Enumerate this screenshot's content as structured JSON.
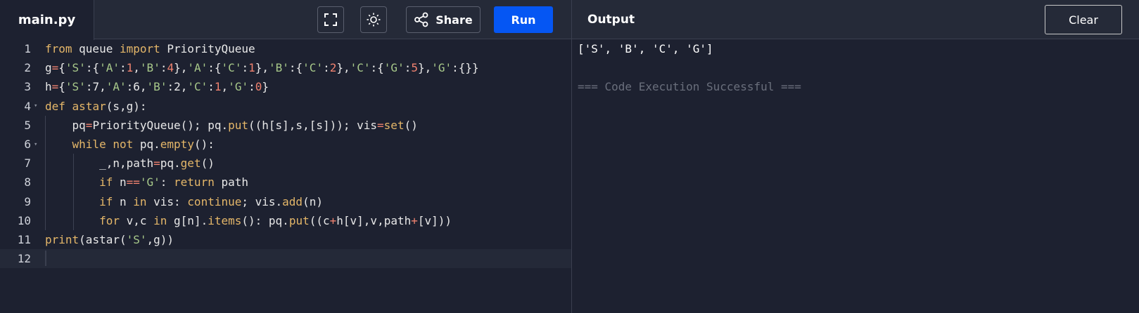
{
  "editor": {
    "file_tab": "main.py",
    "lines": [
      {
        "n": "1",
        "html_tokens": [
          [
            "kw",
            "from"
          ],
          [
            "t",
            " queue "
          ],
          [
            "kw",
            "import"
          ],
          [
            "t",
            " PriorityQueue"
          ]
        ]
      },
      {
        "n": "2",
        "html_tokens": [
          [
            "t",
            "g"
          ],
          [
            "op",
            "="
          ],
          [
            "t",
            "{"
          ],
          [
            "str",
            "'S'"
          ],
          [
            "t",
            ":{"
          ],
          [
            "str",
            "'A'"
          ],
          [
            "t",
            ":"
          ],
          [
            "num",
            "1"
          ],
          [
            "t",
            ","
          ],
          [
            "str",
            "'B'"
          ],
          [
            "t",
            ":"
          ],
          [
            "num",
            "4"
          ],
          [
            "t",
            "},"
          ],
          [
            "str",
            "'A'"
          ],
          [
            "t",
            ":{"
          ],
          [
            "str",
            "'C'"
          ],
          [
            "t",
            ":"
          ],
          [
            "num",
            "1"
          ],
          [
            "t",
            "},"
          ],
          [
            "str",
            "'B'"
          ],
          [
            "t",
            ":{"
          ],
          [
            "str",
            "'C'"
          ],
          [
            "t",
            ":"
          ],
          [
            "num",
            "2"
          ],
          [
            "t",
            "},"
          ],
          [
            "str",
            "'C'"
          ],
          [
            "t",
            ":{"
          ],
          [
            "str",
            "'G'"
          ],
          [
            "t",
            ":"
          ],
          [
            "num",
            "5"
          ],
          [
            "t",
            "},"
          ],
          [
            "str",
            "'G'"
          ],
          [
            "t",
            ":{}}"
          ]
        ]
      },
      {
        "n": "3",
        "html_tokens": [
          [
            "t",
            "h"
          ],
          [
            "op",
            "="
          ],
          [
            "t",
            "{"
          ],
          [
            "str",
            "'S'"
          ],
          [
            "t",
            ":7,"
          ],
          [
            "str",
            "'A'"
          ],
          [
            "t",
            ":6,"
          ],
          [
            "str",
            "'B'"
          ],
          [
            "t",
            ":2,"
          ],
          [
            "str",
            "'C'"
          ],
          [
            "t",
            ":"
          ],
          [
            "num",
            "1"
          ],
          [
            "t",
            ","
          ],
          [
            "str",
            "'G'"
          ],
          [
            "t",
            ":"
          ],
          [
            "num",
            "0"
          ],
          [
            "t",
            "}"
          ]
        ]
      },
      {
        "n": "4",
        "fold": true,
        "html_tokens": [
          [
            "kw",
            "def"
          ],
          [
            "t",
            " "
          ],
          [
            "fn",
            "astar"
          ],
          [
            "t",
            "(s,g):"
          ]
        ]
      },
      {
        "n": "5",
        "html_tokens": [
          [
            "t",
            "    pq"
          ],
          [
            "op",
            "="
          ],
          [
            "t",
            "PriorityQueue(); pq."
          ],
          [
            "fn",
            "put"
          ],
          [
            "t",
            "((h[s],s,[s])); vis"
          ],
          [
            "op",
            "="
          ],
          [
            "fn",
            "set"
          ],
          [
            "t",
            "()"
          ]
        ]
      },
      {
        "n": "6",
        "fold": true,
        "html_tokens": [
          [
            "t",
            "    "
          ],
          [
            "kw",
            "while"
          ],
          [
            "t",
            " "
          ],
          [
            "kw",
            "not"
          ],
          [
            "t",
            " pq."
          ],
          [
            "fn",
            "empty"
          ],
          [
            "t",
            "():"
          ]
        ]
      },
      {
        "n": "7",
        "html_tokens": [
          [
            "t",
            "        _,n,path"
          ],
          [
            "op",
            "="
          ],
          [
            "t",
            "pq."
          ],
          [
            "fn",
            "get"
          ],
          [
            "t",
            "()"
          ]
        ]
      },
      {
        "n": "8",
        "html_tokens": [
          [
            "t",
            "        "
          ],
          [
            "kw",
            "if"
          ],
          [
            "t",
            " n"
          ],
          [
            "op",
            "=="
          ],
          [
            "str",
            "'G'"
          ],
          [
            "t",
            ": "
          ],
          [
            "kw",
            "return"
          ],
          [
            "t",
            " path"
          ]
        ]
      },
      {
        "n": "9",
        "html_tokens": [
          [
            "t",
            "        "
          ],
          [
            "kw",
            "if"
          ],
          [
            "t",
            " n "
          ],
          [
            "kw",
            "in"
          ],
          [
            "t",
            " vis: "
          ],
          [
            "kw",
            "continue"
          ],
          [
            "t",
            "; vis."
          ],
          [
            "fn",
            "add"
          ],
          [
            "t",
            "(n)"
          ]
        ]
      },
      {
        "n": "10",
        "html_tokens": [
          [
            "t",
            "        "
          ],
          [
            "kw",
            "for"
          ],
          [
            "t",
            " v,c "
          ],
          [
            "kw",
            "in"
          ],
          [
            "t",
            " g[n]."
          ],
          [
            "fn",
            "items"
          ],
          [
            "t",
            "(): pq."
          ],
          [
            "fn",
            "put"
          ],
          [
            "t",
            "((c"
          ],
          [
            "op",
            "+"
          ],
          [
            "t",
            "h[v],v,path"
          ],
          [
            "op",
            "+"
          ],
          [
            "t",
            "[v]))"
          ]
        ]
      },
      {
        "n": "11",
        "html_tokens": [
          [
            "fn",
            "print"
          ],
          [
            "t",
            "(astar("
          ],
          [
            "str",
            "'S'"
          ],
          [
            "t",
            ",g))"
          ]
        ]
      },
      {
        "n": "12",
        "active": true,
        "html_tokens": []
      }
    ]
  },
  "toolbar": {
    "fullscreen_icon": "fullscreen-icon",
    "theme_icon": "sun-icon",
    "share_label": "Share",
    "share_icon": "share-icon",
    "run_label": "Run"
  },
  "output": {
    "title": "Output",
    "clear_label": "Clear",
    "result": "['S', 'B', 'C', 'G']",
    "status": "=== Code Execution Successful ==="
  },
  "colors": {
    "background": "#1d2130",
    "run_button": "#0556f3",
    "keyword": "#e5b769",
    "string": "#a8c98a",
    "number": "#f0826f"
  }
}
